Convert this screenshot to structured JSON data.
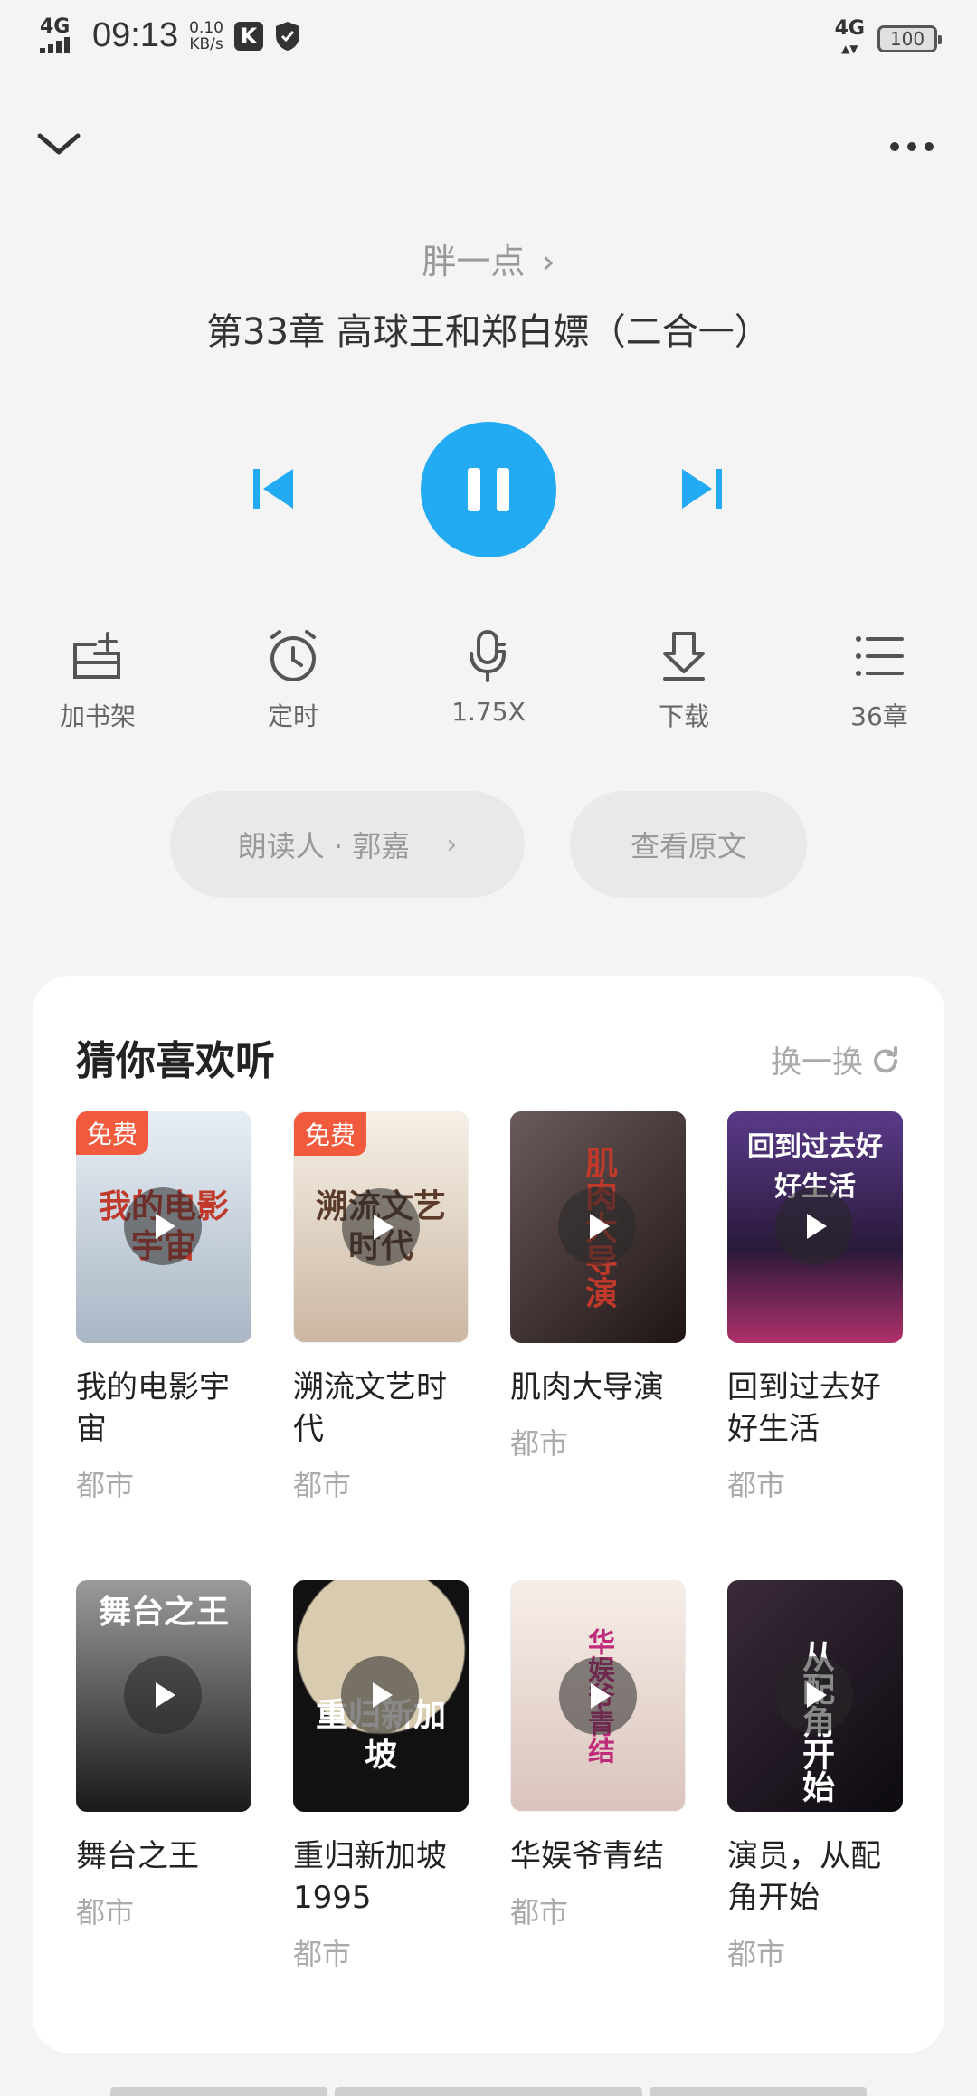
{
  "status_bar": {
    "network_left": "4G",
    "time": "09:13",
    "speed_value": "0.10",
    "speed_unit": "KB/s",
    "app_badge": "K",
    "network_right": "4G",
    "battery": "100"
  },
  "player": {
    "book_title": "胖一点",
    "chapter_title": "第33章 高球王和郑白嫖（二合一）",
    "accent_color": "#22aaf2"
  },
  "actions": [
    {
      "icon": "bookshelf-add-icon",
      "label": "加书架"
    },
    {
      "icon": "timer-icon",
      "label": "定时"
    },
    {
      "icon": "microphone-speed-icon",
      "label": "1.75X"
    },
    {
      "icon": "download-icon",
      "label": "下载"
    },
    {
      "icon": "chapter-list-icon",
      "label": "36章"
    }
  ],
  "pills": {
    "reader": "朗读人 · 郭嘉",
    "original": "查看原文"
  },
  "recommend": {
    "title": "猜你喜欢听",
    "refresh": "换一换",
    "badge_free": "免费",
    "books": [
      {
        "name": "我的电影宇宙",
        "category": "都市",
        "free": true,
        "cover_text": "我的电影宇宙",
        "cover_bg": "#cfd8e2",
        "cover_color": "#c0392b"
      },
      {
        "name": "溯流文艺时代",
        "category": "都市",
        "free": true,
        "cover_text": "溯流文艺时代",
        "cover_bg": "#efe6da",
        "cover_color": "#5a3b2a"
      },
      {
        "name": "肌肉大导演",
        "category": "都市",
        "free": false,
        "cover_text": "肌肉大导演",
        "cover_bg": "#3a2a2a",
        "cover_color": "#c0392b"
      },
      {
        "name": "回到过去好好生活",
        "category": "都市",
        "free": false,
        "cover_text": "回到过去好好生活",
        "cover_bg": "#4a3a6a",
        "cover_color": "#ffffff"
      },
      {
        "name": "舞台之王",
        "category": "都市",
        "free": false,
        "cover_text": "舞台之王",
        "cover_bg": "#555555",
        "cover_color": "#ffffff"
      },
      {
        "name": "重归新加坡1995",
        "category": "都市",
        "free": false,
        "cover_text": "重归新加坡",
        "cover_bg": "#2b2b2b",
        "cover_color": "#ffffff"
      },
      {
        "name": "华娱爷青结",
        "category": "都市",
        "free": false,
        "cover_text": "华娱爷青结",
        "cover_bg": "#f2e6e2",
        "cover_color": "#c02a7a"
      },
      {
        "name": "演员，从配角开始",
        "category": "都市",
        "free": false,
        "cover_text": "从配角开始",
        "cover_bg": "#1e1a24",
        "cover_color": "#ffffff"
      }
    ]
  }
}
